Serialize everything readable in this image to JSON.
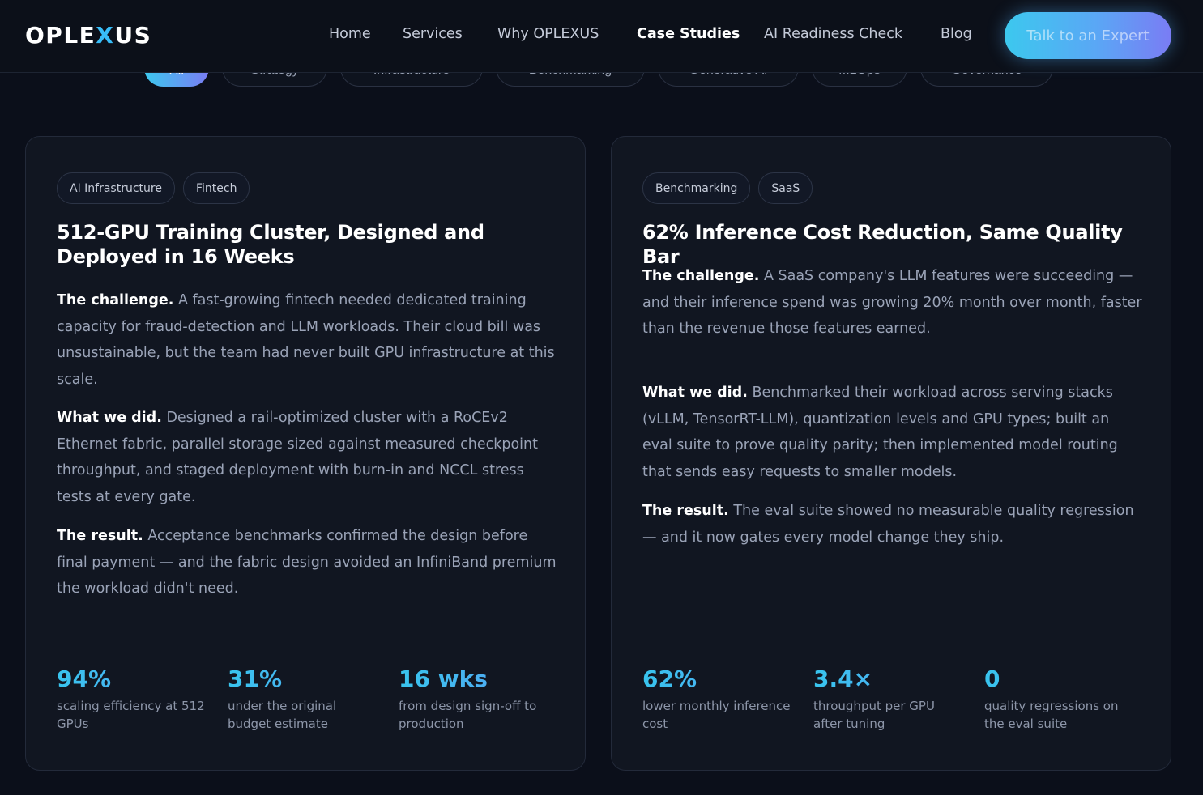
{
  "brand": {
    "prefix": "OPLE",
    "x": "X",
    "suffix": "US"
  },
  "nav": {
    "items": [
      "Home",
      "Services",
      "Why OPLEXUS",
      "Case Studies",
      "AI Readiness Check",
      "Blog"
    ],
    "cta_label": "Talk to an Expert"
  },
  "filters": [
    "All",
    "Strategy",
    "Infrastructure",
    "Benchmarking",
    "Generative AI",
    "MLOps",
    "Governance"
  ],
  "cards": [
    {
      "tags": [
        "AI Infrastructure",
        "Fintech"
      ],
      "title": "512-GPU Training Cluster, Designed and Deployed in 16 Weeks",
      "challenge_label": "The challenge.",
      "challenge_text": "A fast-growing fintech needed dedicated training capacity for fraud-detection and LLM workloads. Their cloud bill was unsustainable, but the team had never built GPU infrastructure at this scale.",
      "did_label": "What we did.",
      "did_text": "Designed a rail-optimized cluster with a RoCEv2 Ethernet fabric, parallel storage sized against measured checkpoint throughput, and staged deployment with burn-in and NCCL stress tests at every gate.",
      "result_label": "The result.",
      "result_text": "Acceptance benchmarks confirmed the design before final payment — and the fabric design avoided an InfiniBand premium the workload didn't need.",
      "stats": [
        {
          "value": "94%",
          "label": "scaling efficiency at 512 GPUs"
        },
        {
          "value": "31%",
          "label": "under the original budget estimate"
        },
        {
          "value": "16 wks",
          "label": "from design sign-off to production"
        }
      ]
    },
    {
      "tags": [
        "Benchmarking",
        "SaaS"
      ],
      "title": "62% Inference Cost Reduction, Same Quality Bar",
      "challenge_label": "The challenge.",
      "challenge_text": "A SaaS company's LLM features were succeeding — and their inference spend was growing 20% month over month, faster than the revenue those features earned.",
      "did_label": "What we did.",
      "did_text": "Benchmarked their workload across serving stacks (vLLM, TensorRT-LLM), quantization levels and GPU types; built an eval suite to prove quality parity; then implemented model routing that sends easy requests to smaller models.",
      "result_label": "The result.",
      "result_text": "The eval suite showed no measurable quality regression — and it now gates every model change they ship.",
      "stats": [
        {
          "value": "62%",
          "label": "lower monthly inference cost"
        },
        {
          "value": "3.4×",
          "label": "throughput per GPU after tuning"
        },
        {
          "value": "0",
          "label": "quality regressions on the eval suite"
        }
      ]
    }
  ]
}
